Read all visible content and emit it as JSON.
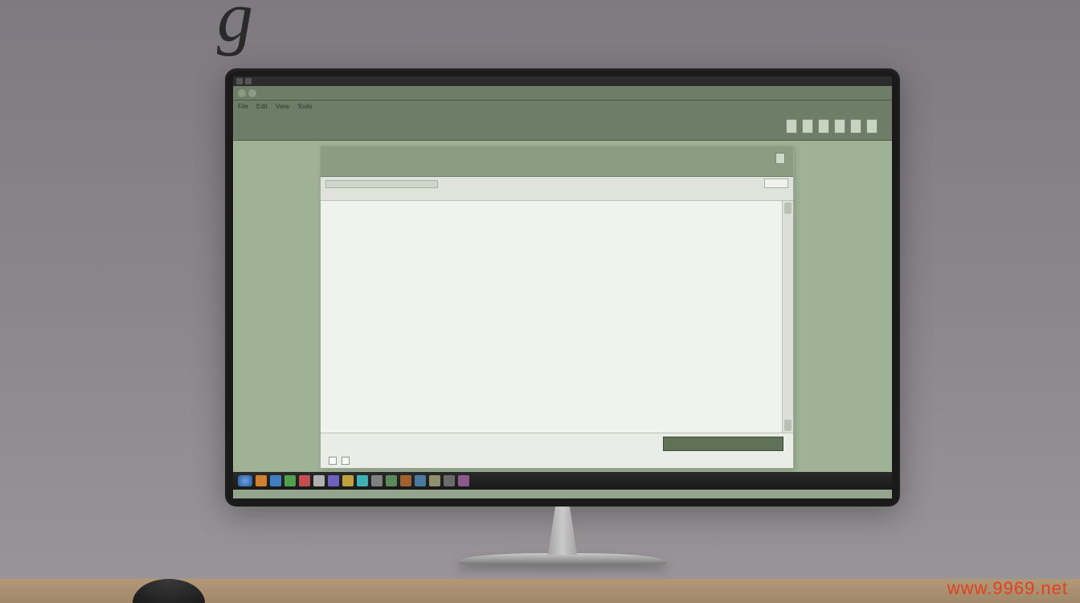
{
  "decor": {
    "top_letter": "g",
    "watermark": "www.9969.net"
  },
  "browser": {
    "address": "",
    "menu": [
      "File",
      "Edit",
      "View",
      "Tools"
    ],
    "ribbon_left": "",
    "ribbon_right_label": ""
  },
  "dialog": {
    "title": "",
    "subtitle": "",
    "toolbar_line": "",
    "body": {
      "p1": "",
      "p2": "",
      "p3a": "",
      "p3b": "",
      "p4a": "",
      "p4b": "",
      "p4c": "",
      "closing": "",
      "sig1": "",
      "sig2": "",
      "sig3": "",
      "link": ""
    },
    "primary_button": "",
    "footer_label": ""
  }
}
